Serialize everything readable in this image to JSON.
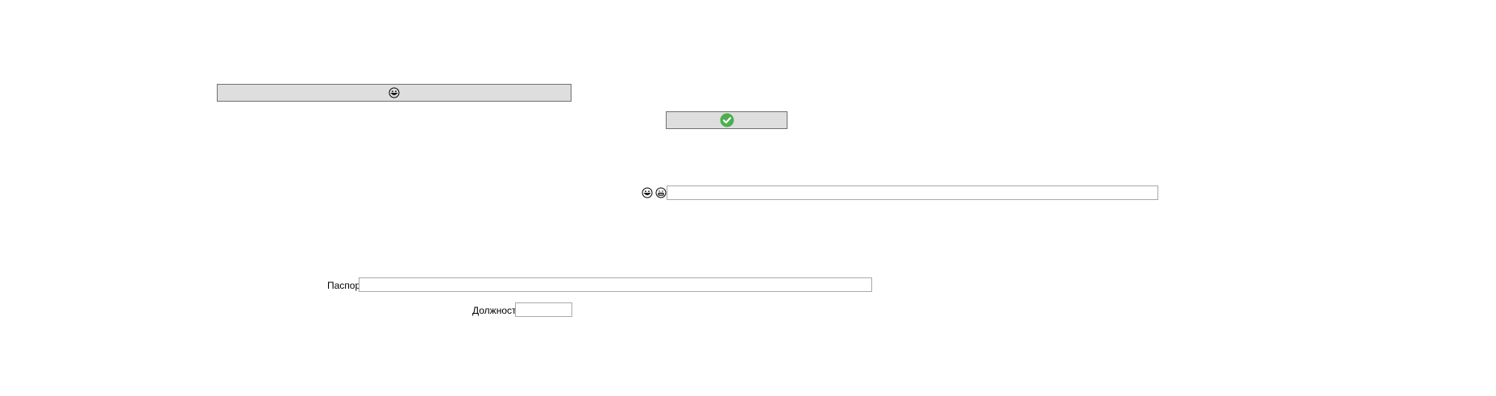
{
  "buttons": {
    "top_wide": {
      "icon": "grinning-emoji-icon"
    },
    "confirm": {
      "icon": "check-circle-icon",
      "icon_color": "#4caf50"
    }
  },
  "middle_row": {
    "icons": [
      "grinning-emoji-icon",
      "smiling-emoji-icon"
    ]
  },
  "form": {
    "passport_label": "Паспорт",
    "passport_value": "",
    "position_label": "Должность",
    "position_value": ""
  },
  "colors": {
    "button_bg": "#dedede",
    "button_border": "#707070",
    "field_border": "#a9a9a9",
    "check_green": "#4caf50"
  }
}
